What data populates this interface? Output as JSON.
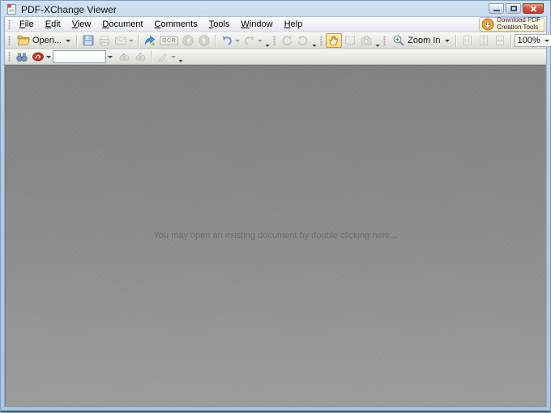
{
  "window": {
    "title": "PDF-XChange Viewer"
  },
  "menu": {
    "items": [
      {
        "label": "File"
      },
      {
        "label": "Edit"
      },
      {
        "label": "View"
      },
      {
        "label": "Document"
      },
      {
        "label": "Comments"
      },
      {
        "label": "Tools"
      },
      {
        "label": "Window"
      },
      {
        "label": "Help"
      }
    ]
  },
  "promo": {
    "label_line1": "Download PDF",
    "label_line2": "Creation Tools"
  },
  "toolbars": {
    "open_label": "Open...",
    "ocr_label": "OCR",
    "zoom_in_label": "Zoom In",
    "zoom_value": "100%",
    "find_value": ""
  },
  "document_area": {
    "placeholder": "You may open an existing document by double clicking here..."
  },
  "colors": {
    "titlebar_blue": "#b4cde6",
    "close_button_red": "#c84a33",
    "selected_tool_yellow": "#f7da76",
    "toolbar_gray": "#ebebe7",
    "doc_background_gray": "#8d8d8d",
    "placeholder_text_gray": "#6d6d6d",
    "accent_green": "#7ab648",
    "promo_orange": "#e8a33c"
  }
}
